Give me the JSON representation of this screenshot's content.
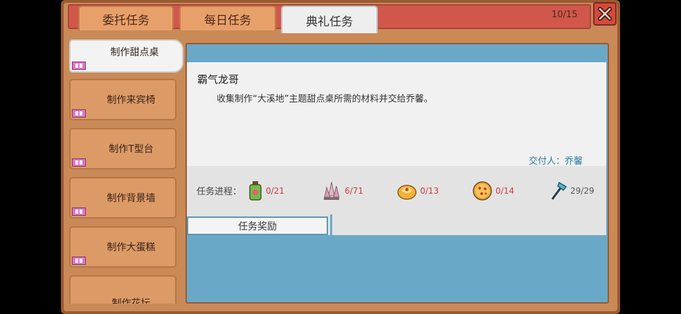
{
  "tabs": [
    {
      "label": "委托任务"
    },
    {
      "label": "每日任务"
    },
    {
      "label": "典礼任务"
    }
  ],
  "counter": "10/15",
  "sidebar": {
    "items": [
      {
        "label": "制作甜点桌"
      },
      {
        "label": "制作来宾椅"
      },
      {
        "label": "制作T型台"
      },
      {
        "label": "制作背景墙"
      },
      {
        "label": "制作大蛋糕"
      },
      {
        "label": "制作花坛"
      }
    ]
  },
  "task": {
    "title": "霸气龙哥",
    "description": "收集制作“大溪地”主题甜点桌所需的材料并交给乔馨。",
    "giver": "交付人：乔馨",
    "progress_label": "任务进程：",
    "items": [
      {
        "icon": "green-bottle-icon",
        "count": "0/21"
      },
      {
        "icon": "pink-crystal-icon",
        "count": "6/71"
      },
      {
        "icon": "bread-icon",
        "count": "0/13"
      },
      {
        "icon": "pizza-icon",
        "count": "0/14"
      },
      {
        "icon": "axe-tool-icon",
        "count": "29/29"
      }
    ],
    "reward_tab": "任务奖励"
  },
  "colors": {
    "accent": "#6aa8c8",
    "incomplete": "#d13b3b",
    "header": "#d1574b"
  }
}
